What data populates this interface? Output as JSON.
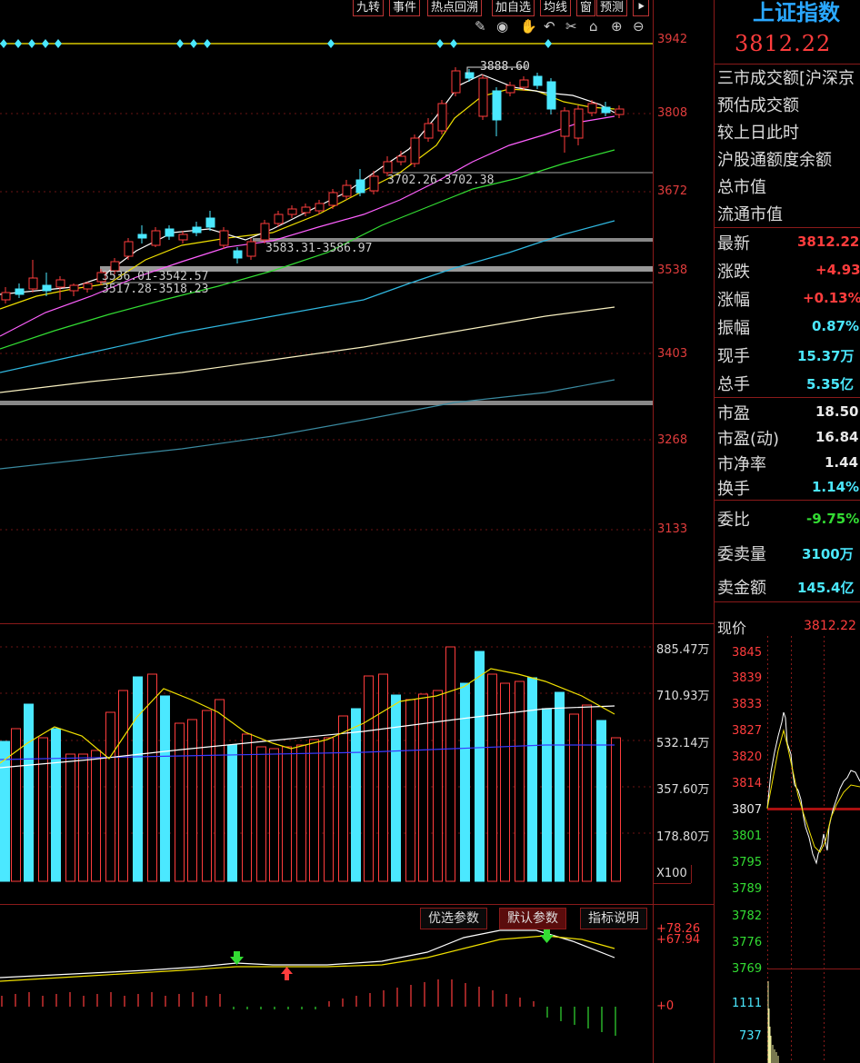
{
  "toolbar": {
    "buttons": [
      "九转",
      "事件",
      "热点回溯",
      "加自选",
      "均线",
      "窗",
      "预测",
      "⯈"
    ],
    "tools": [
      "pen-icon",
      "eye-icon",
      "hand-icon",
      "undo-icon",
      "scissors-icon",
      "lock-icon",
      "zoom-in-icon",
      "zoom-out-icon"
    ]
  },
  "main_axis": {
    "labels": [
      "3942",
      "3808",
      "3672",
      "3538",
      "3403",
      "3268",
      "3133"
    ]
  },
  "annotations": {
    "high": "3888.60",
    "gap1": "3702.26-3702.38",
    "gap2": "3583.31-3586.97",
    "gap3": "3536.01-3542.57",
    "gap4": "3517.28-3518.23"
  },
  "volume_axis": {
    "labels": [
      "885.47万",
      "710.93万",
      "532.14万",
      "357.60万",
      "178.80万"
    ],
    "multiplier": "X100"
  },
  "indicator": {
    "buttons": [
      "优选参数",
      "默认参数",
      "指标说明"
    ],
    "value1": "+78.26",
    "value2": "+67.94",
    "zero": "+0"
  },
  "right_panel": {
    "title": "上证指数",
    "price": "3812.22",
    "info_rows": [
      "三市成交额[沪深京",
      "预估成交额",
      "较上日此时",
      "沪股通额度余额",
      "总市值",
      "流通市值"
    ],
    "quote_rows": [
      {
        "label": "最新",
        "value": "3812.22",
        "color": "red"
      },
      {
        "label": "涨跌",
        "value": "+4.93",
        "color": "red"
      },
      {
        "label": "涨幅",
        "value": "+0.13%",
        "color": "red"
      },
      {
        "label": "振幅",
        "value": "0.87%",
        "color": "cyan"
      },
      {
        "label": "现手",
        "value": "15.37万",
        "color": "cyan"
      },
      {
        "label": "总手",
        "value": "5.35亿",
        "color": "cyan"
      }
    ],
    "valuation_rows": [
      {
        "label": "市盈",
        "value": "18.50"
      },
      {
        "label": "市盈(动)",
        "value": "16.84"
      },
      {
        "label": "市净率",
        "value": "1.44"
      },
      {
        "label": "换手",
        "value": "1.14%"
      }
    ],
    "order_rows": [
      {
        "label": "委比",
        "value": "-9.75%",
        "color": "green"
      },
      {
        "label": "委卖量",
        "value": "3100万",
        "color": "cyan"
      },
      {
        "label": "卖金额",
        "value": "145.4亿",
        "color": "cyan"
      }
    ],
    "mini_label": "现价",
    "mini_value": "3812.22",
    "mini_axis": [
      "3845",
      "3839",
      "3833",
      "3827",
      "3820",
      "3814",
      "3807",
      "3801",
      "3795",
      "3789",
      "3782",
      "3776",
      "3769"
    ],
    "mini_vol_axis": [
      "1111",
      "737"
    ]
  },
  "colors": {
    "up": "#ff3d3d",
    "down": "#4be8ff",
    "grid": "#8a1a1a",
    "ma5": "#ffffff",
    "ma10": "#f0e000",
    "ma20": "#ff60ff",
    "ma30": "#33dd33",
    "ma60": "#30b8e0",
    "ma120": "#f8f0c0",
    "ma250": "#3a8aa0"
  }
}
